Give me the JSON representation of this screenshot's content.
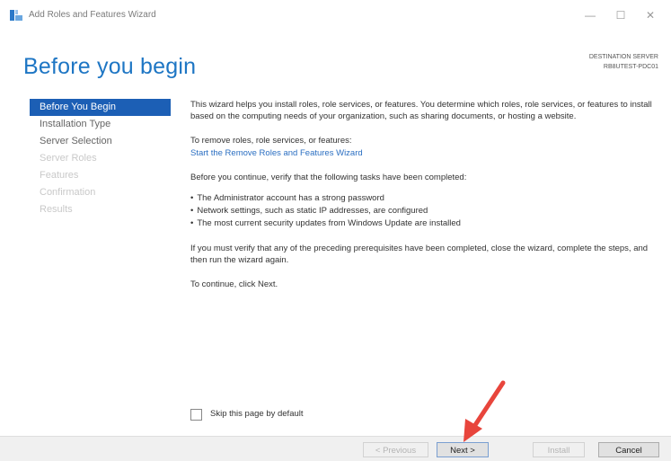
{
  "window": {
    "title": "Add Roles and Features Wizard",
    "controls": {
      "minimize": "—",
      "maximize": "☐",
      "close": "✕"
    }
  },
  "page": {
    "title": "Before you begin"
  },
  "destination": {
    "label": "DESTINATION SERVER",
    "server": "RB8UTEST-PDC01"
  },
  "nav": {
    "items": [
      {
        "label": "Before You Begin",
        "state": "active"
      },
      {
        "label": "Installation Type",
        "state": "normal"
      },
      {
        "label": "Server Selection",
        "state": "normal"
      },
      {
        "label": "Server Roles",
        "state": "disabled"
      },
      {
        "label": "Features",
        "state": "disabled"
      },
      {
        "label": "Confirmation",
        "state": "disabled"
      },
      {
        "label": "Results",
        "state": "disabled"
      }
    ]
  },
  "content": {
    "intro": "This wizard helps you install roles, role services, or features. You determine which roles, role services, or features to install based on the computing needs of your organization, such as sharing documents, or hosting a website.",
    "remove_text": "To remove roles, role services, or features:",
    "remove_link": "Start the Remove Roles and Features Wizard",
    "verify_text": "Before you continue, verify that the following tasks have been completed:",
    "bullets": [
      "The Administrator account has a strong password",
      "Network settings, such as static IP addresses, are configured",
      "The most current security updates from Windows Update are installed"
    ],
    "prereq_text": "If you must verify that any of the preceding prerequisites have been completed, close the wizard, complete the steps, and then run the wizard again.",
    "continue_text": "To continue, click Next."
  },
  "skip": {
    "label": "Skip this page by default",
    "checked": false
  },
  "buttons": {
    "previous": "< Previous",
    "next": "Next >",
    "install": "Install",
    "cancel": "Cancel"
  },
  "colors": {
    "accent": "#1c5fb5",
    "title": "#1e76c4",
    "annotation_arrow": "#e8453c"
  },
  "annotation": {
    "icon": "red-arrow-pointing-to-next"
  }
}
